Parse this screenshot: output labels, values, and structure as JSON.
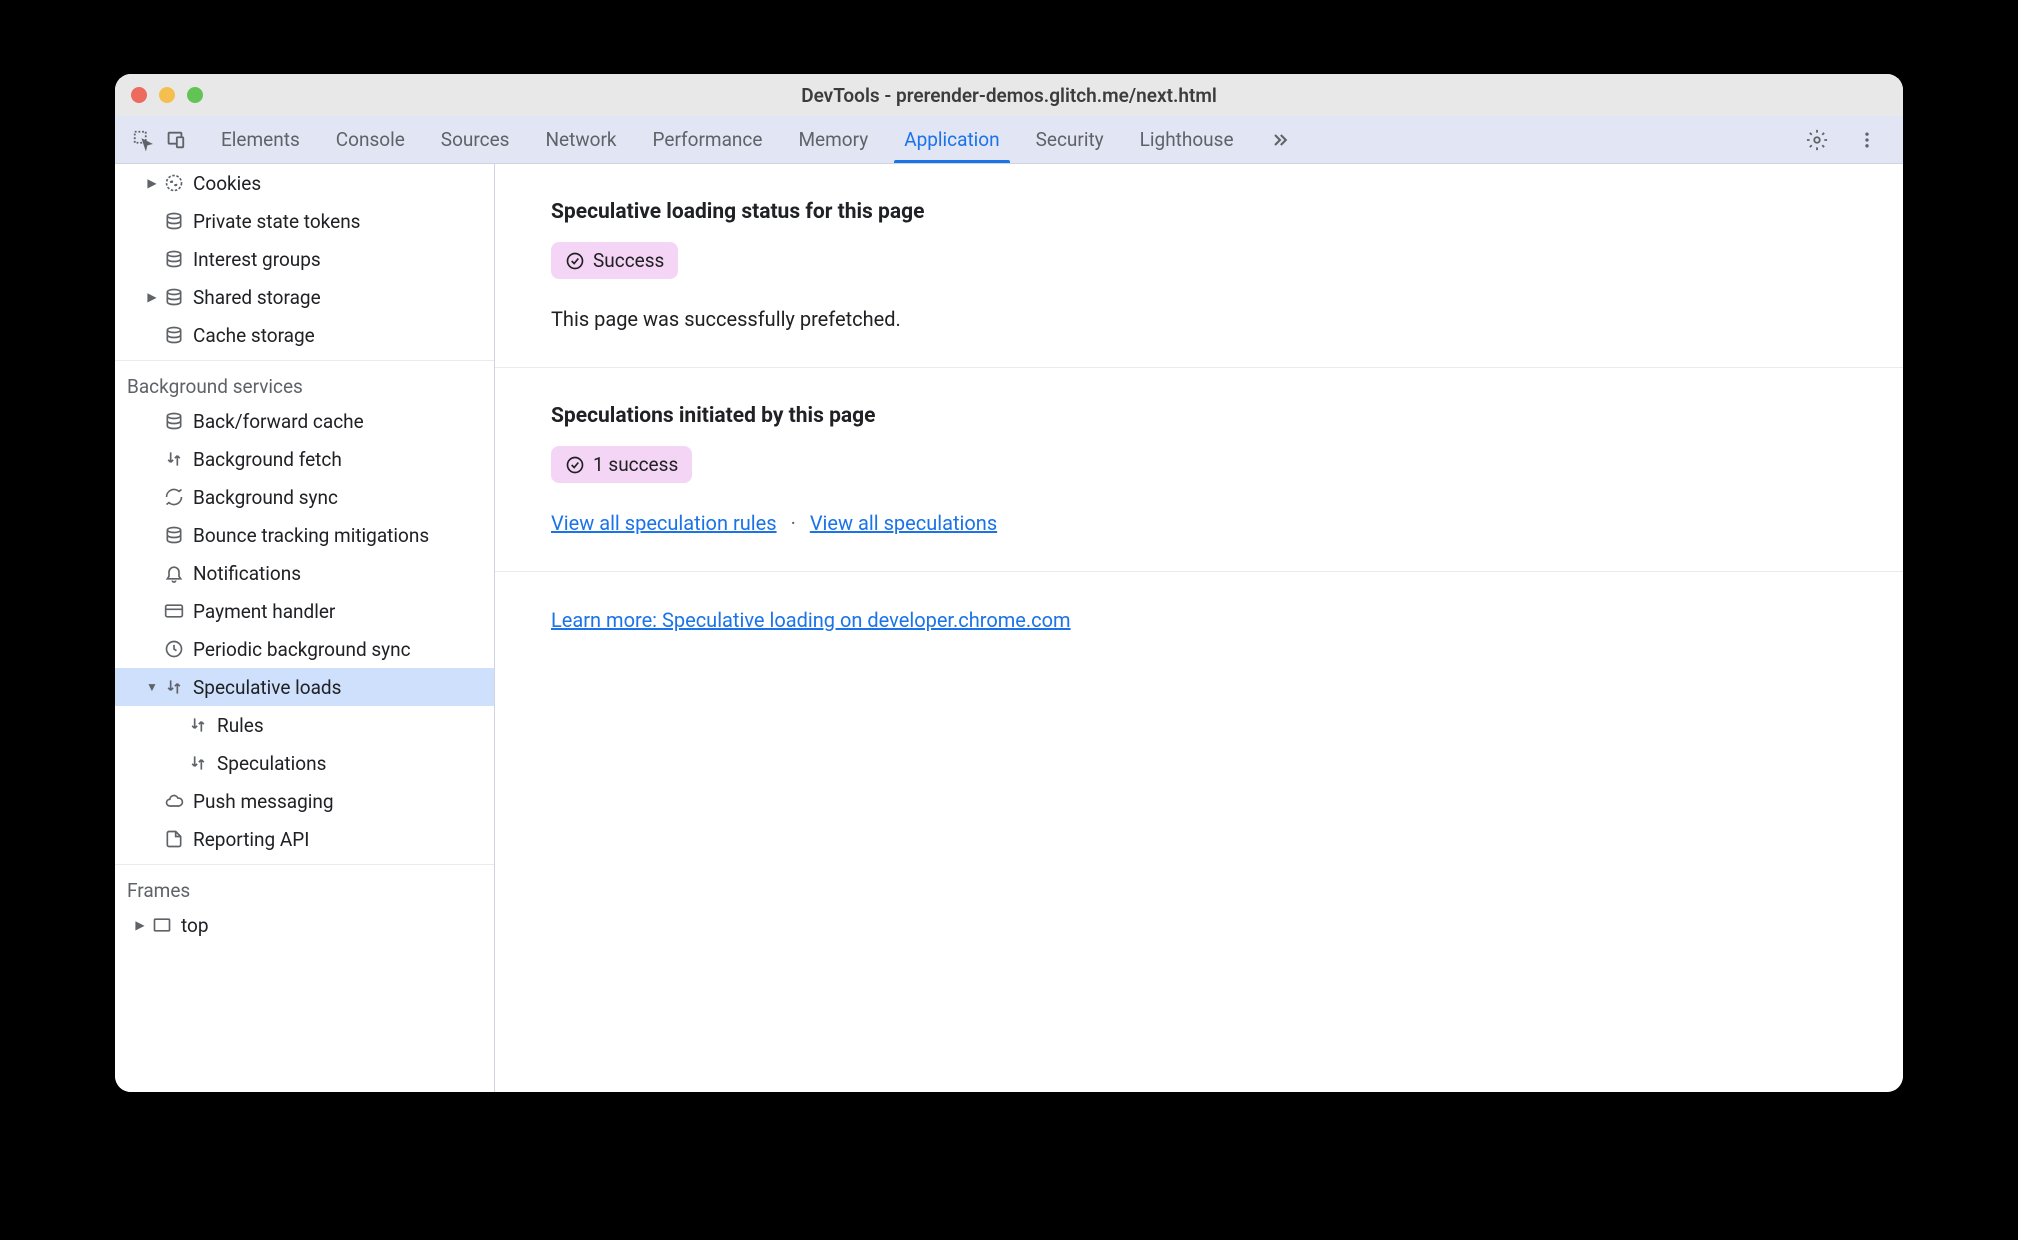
{
  "window": {
    "title": "DevTools - prerender-demos.glitch.me/next.html"
  },
  "tabs": [
    {
      "label": "Elements",
      "active": false
    },
    {
      "label": "Console",
      "active": false
    },
    {
      "label": "Sources",
      "active": false
    },
    {
      "label": "Network",
      "active": false
    },
    {
      "label": "Performance",
      "active": false
    },
    {
      "label": "Memory",
      "active": false
    },
    {
      "label": "Application",
      "active": true
    },
    {
      "label": "Security",
      "active": false
    },
    {
      "label": "Lighthouse",
      "active": false
    }
  ],
  "sidebar": {
    "storage_items": [
      {
        "label": "Cookies",
        "icon": "cookie",
        "expandable": true
      },
      {
        "label": "Private state tokens",
        "icon": "database",
        "expandable": false
      },
      {
        "label": "Interest groups",
        "icon": "database",
        "expandable": false
      },
      {
        "label": "Shared storage",
        "icon": "database",
        "expandable": true
      },
      {
        "label": "Cache storage",
        "icon": "database",
        "expandable": false
      }
    ],
    "bg_header": "Background services",
    "bg_items": [
      {
        "label": "Back/forward cache",
        "icon": "database"
      },
      {
        "label": "Background fetch",
        "icon": "updown"
      },
      {
        "label": "Background sync",
        "icon": "sync"
      },
      {
        "label": "Bounce tracking mitigations",
        "icon": "database"
      },
      {
        "label": "Notifications",
        "icon": "bell"
      },
      {
        "label": "Payment handler",
        "icon": "card"
      },
      {
        "label": "Periodic background sync",
        "icon": "clock"
      },
      {
        "label": "Speculative loads",
        "icon": "updown",
        "selected": true,
        "expanded": true
      },
      {
        "label": "Rules",
        "icon": "updown",
        "child": true
      },
      {
        "label": "Speculations",
        "icon": "updown",
        "child": true
      },
      {
        "label": "Push messaging",
        "icon": "cloud"
      },
      {
        "label": "Reporting API",
        "icon": "file"
      }
    ],
    "frames_header": "Frames",
    "frames_items": [
      {
        "label": "top",
        "icon": "frame",
        "expandable": true
      }
    ]
  },
  "main": {
    "section1": {
      "heading": "Speculative loading status for this page",
      "status": "Success",
      "description": "This page was successfully prefetched."
    },
    "section2": {
      "heading": "Speculations initiated by this page",
      "status": "1 success",
      "link1": "View all speculation rules",
      "link2": "View all speculations"
    },
    "learn_more": "Learn more: Speculative loading on developer.chrome.com"
  }
}
